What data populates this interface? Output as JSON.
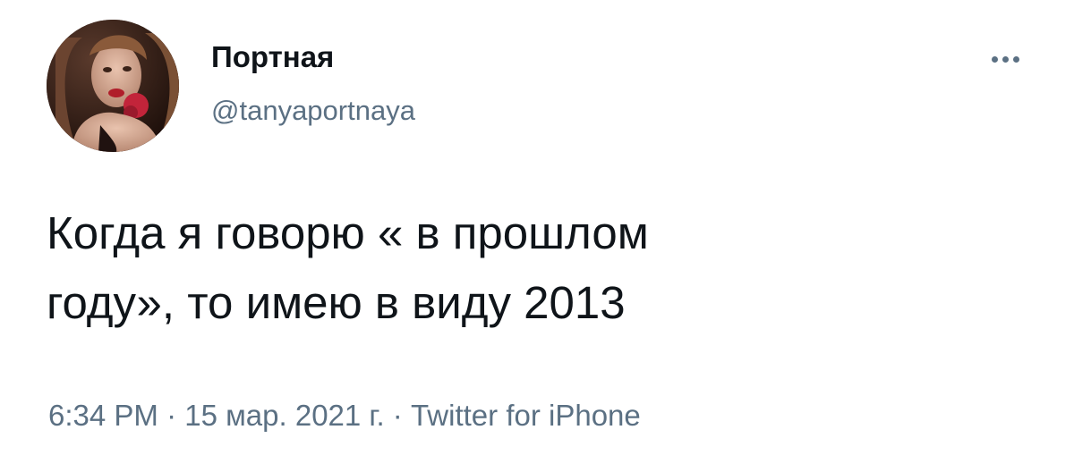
{
  "tweet": {
    "author_name": "Портная",
    "author_handle": "@tanyaportnaya",
    "text_line_1": "Когда я говорю « в прошлом",
    "text_line_2": "году», то имею в виду 2013",
    "time": "6:34 PM",
    "separator": "·",
    "date": "15 мар. 2021 г.",
    "source": "Twitter for iPhone"
  },
  "icons": {
    "more": "more-horizontal-icon",
    "avatar": "avatar-photo"
  },
  "colors": {
    "text_primary": "#0f1419",
    "text_secondary": "#5b7083",
    "background": "#ffffff"
  }
}
